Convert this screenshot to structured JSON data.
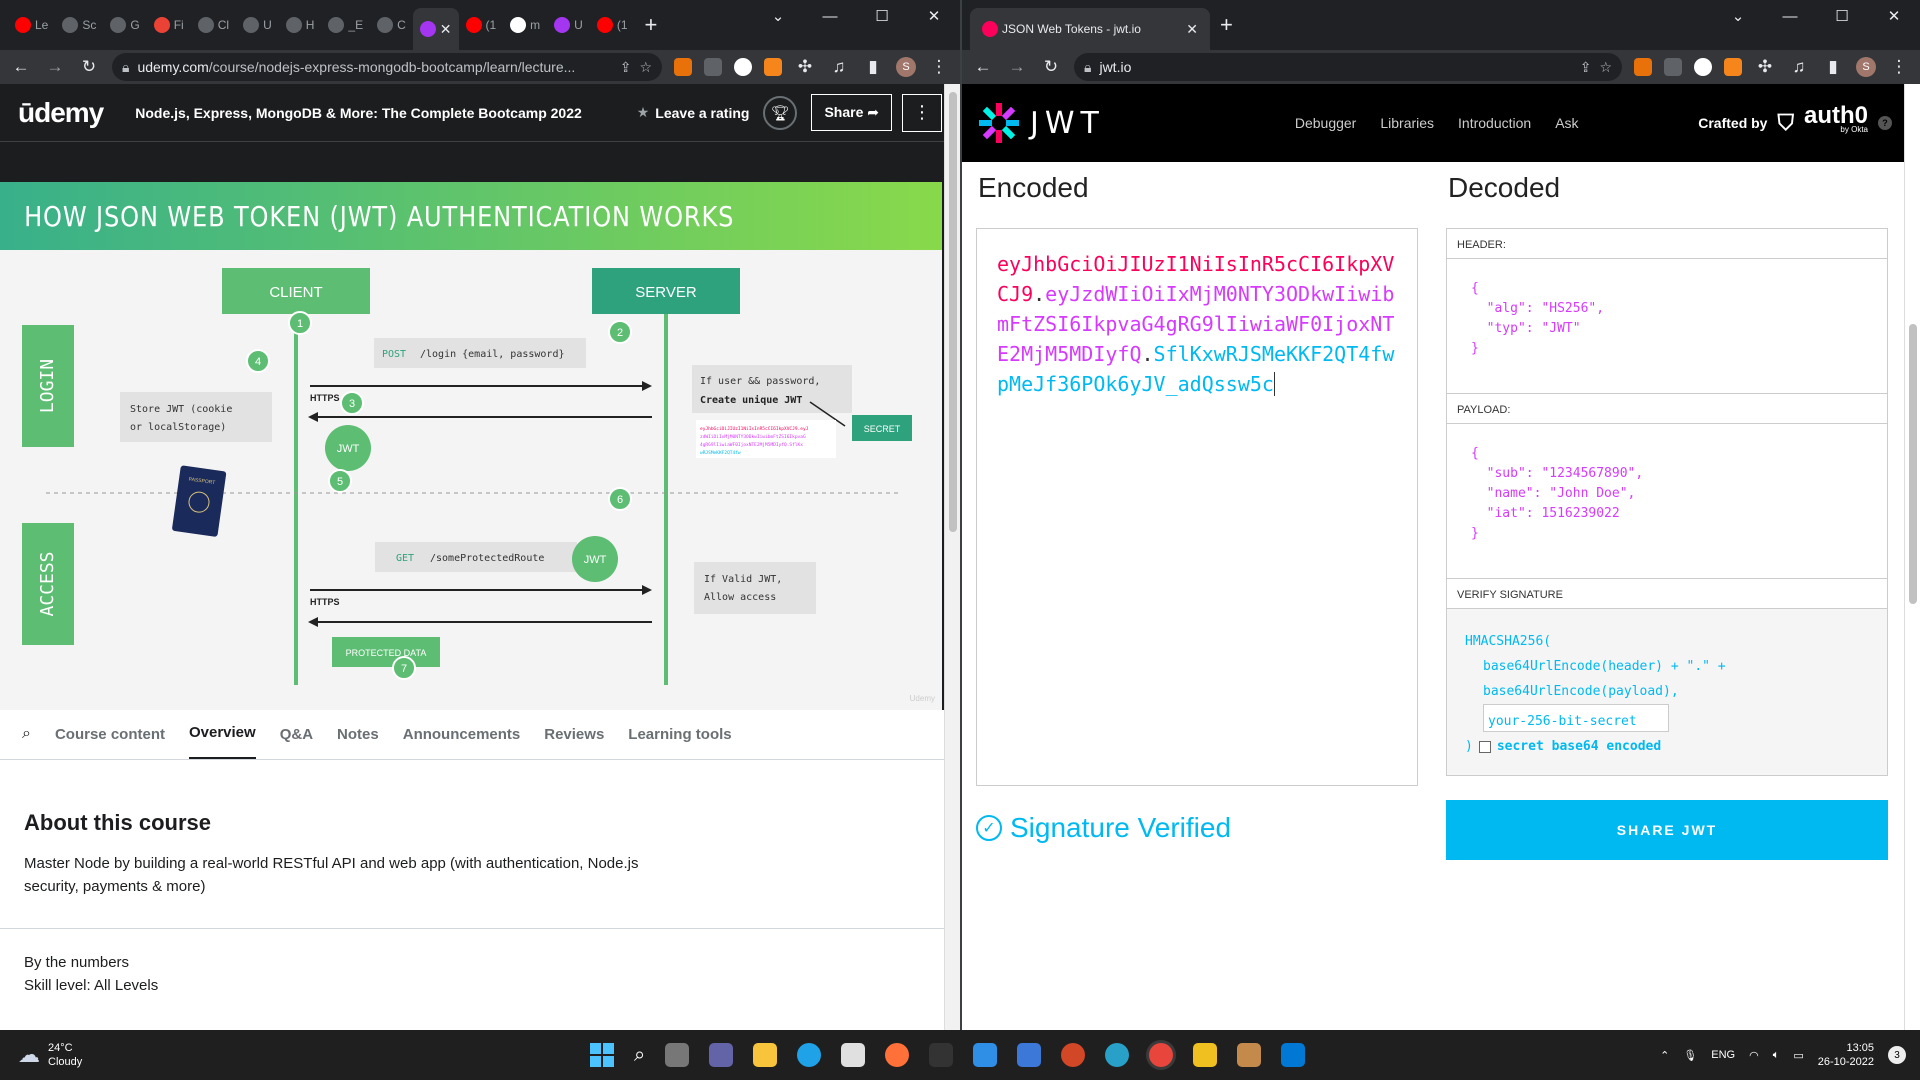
{
  "left_browser": {
    "tabs": [
      {
        "label": "Le",
        "color": "#ff0000"
      },
      {
        "label": "Sc",
        "color": "#5f6368"
      },
      {
        "label": "G",
        "color": "#5f6368"
      },
      {
        "label": "Fi",
        "color": "#ea4335"
      },
      {
        "label": "Cl",
        "color": "#5f6368"
      },
      {
        "label": "U",
        "color": "#5f6368"
      },
      {
        "label": "H",
        "color": "#5f6368"
      },
      {
        "label": "_E",
        "color": "#5f6368"
      },
      {
        "label": "C",
        "color": "#5f6368"
      },
      {
        "label": "",
        "color": "#a435f0"
      },
      {
        "label": "(1",
        "color": "#ff0000"
      },
      {
        "label": "m",
        "color": "#ffffff"
      },
      {
        "label": "U",
        "color": "#a435f0"
      },
      {
        "label": "(1",
        "color": "#ff0000"
      }
    ],
    "url_host": "udemy.com",
    "url_path": "/course/nodejs-express-mongodb-bootcamp/learn/lecture..."
  },
  "udemy": {
    "logo": "ūdemy",
    "course_title": "Node.js, Express, MongoDB & More: The Complete Bootcamp 2022",
    "rating_label": "Leave a rating",
    "share_label": "Share",
    "slide": {
      "title": "HOW JSON WEB TOKEN (JWT) AUTHENTICATION WORKS",
      "client": "CLIENT",
      "server": "SERVER",
      "login": "LOGIN",
      "access": "ACCESS",
      "post": "POST",
      "login_route": "/login  {email, password}",
      "https": "HTTPS",
      "server_check_1": "If user && password,",
      "server_check_2": "Create unique JWT",
      "secret": "SECRET",
      "store_1": "Store JWT (cookie",
      "store_2": "or localStorage)",
      "jwt": "JWT",
      "get": "GET",
      "protected_route": "/someProtectedRoute",
      "valid_1": "If Valid JWT,",
      "valid_2": "Allow access",
      "protected_data": "PROTECTED DATA",
      "watermark": "Udemy",
      "passport": "PASSPORT",
      "steps": [
        "1",
        "2",
        "3",
        "4",
        "5",
        "6",
        "7"
      ]
    },
    "course_tabs": [
      "Course content",
      "Overview",
      "Q&A",
      "Notes",
      "Announcements",
      "Reviews",
      "Learning tools"
    ],
    "active_tab": "Overview",
    "about_title": "About this course",
    "about_text": "Master Node by building a real-world RESTful API and web app (with authentication, Node.js security, payments & more)",
    "by_numbers": "By the numbers",
    "skill_level": "Skill level: All Levels"
  },
  "right_browser": {
    "tab_title": "JSON Web Tokens - jwt.io",
    "url_host": "jwt.io"
  },
  "jwt": {
    "logo": "JWT",
    "nav": [
      "Debugger",
      "Libraries",
      "Introduction",
      "Ask"
    ],
    "crafted_by": "Crafted by",
    "brand": "auth0",
    "brand_sub": "by Okta",
    "encoded_title": "Encoded",
    "decoded_title": "Decoded",
    "token_header": "eyJhbGciOiJIUzI1NiIsInR5cCI6IkpXVCJ9",
    "token_payload": "eyJzdWIiOiIxMjM0NTY3ODkwIiwibmFtZSI6IkpvaG4gRG9lIiwiaWF0IjoxNTE2MjM5MDIyfQ",
    "token_signature": "SflKxwRJSMeKKF2QT4fwpMeJf36POk6yJV_adQssw5c",
    "header_label": "HEADER:",
    "header_lines": [
      "{",
      "  \"alg\": \"HS256\",",
      "  \"typ\": \"JWT\"",
      "}"
    ],
    "payload_label": "PAYLOAD:",
    "payload_lines": [
      "{",
      "  \"sub\": \"1234567890\",",
      "  \"name\": \"John Doe\",",
      "  \"iat\": 1516239022",
      "}"
    ],
    "verify_label": "VERIFY SIGNATURE",
    "verify_fn": "HMACSHA256(",
    "verify_line1": "base64UrlEncode(header) + \".\" +",
    "verify_line2": "base64UrlEncode(payload),",
    "secret_placeholder": "your-256-bit-secret",
    "secret_b64_label": "secret base64 encoded",
    "signature_verified": "Signature Verified",
    "share_button": "SHARE JWT"
  },
  "taskbar": {
    "temp": "24°C",
    "condition": "Cloudy",
    "lang": "ENG",
    "time": "13:05",
    "date": "26-10-2022",
    "notifications": "3"
  }
}
